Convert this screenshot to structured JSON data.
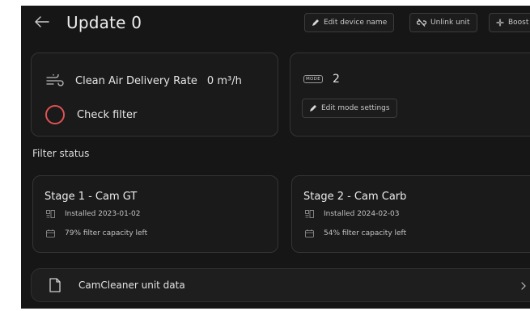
{
  "header": {
    "title": "Update 0",
    "buttons": {
      "edit_device_name": "Edit device name",
      "unlink_unit": "Unlink unit",
      "boost": "Boost"
    }
  },
  "status_card": {
    "cadr_label": "Clean Air Delivery Rate",
    "cadr_value": "0 m³/h",
    "filter_label": "Check filter"
  },
  "mode_card": {
    "badge": "MODE",
    "value": "2",
    "edit_label": "Edit mode settings"
  },
  "filter_status": {
    "title": "Filter status",
    "stages": [
      {
        "name": "Stage 1 - Cam GT",
        "installed": "Installed 2023-01-02",
        "capacity": "79% filter capacity left"
      },
      {
        "name": "Stage 2 - Cam Carb",
        "installed": "Installed 2024-02-03",
        "capacity": "54% filter capacity left"
      }
    ]
  },
  "unit_data": {
    "label": "CamCleaner unit data"
  },
  "colors": {
    "background": "#161616",
    "card": "#1a1a1a",
    "alert_red": "#e05252"
  }
}
